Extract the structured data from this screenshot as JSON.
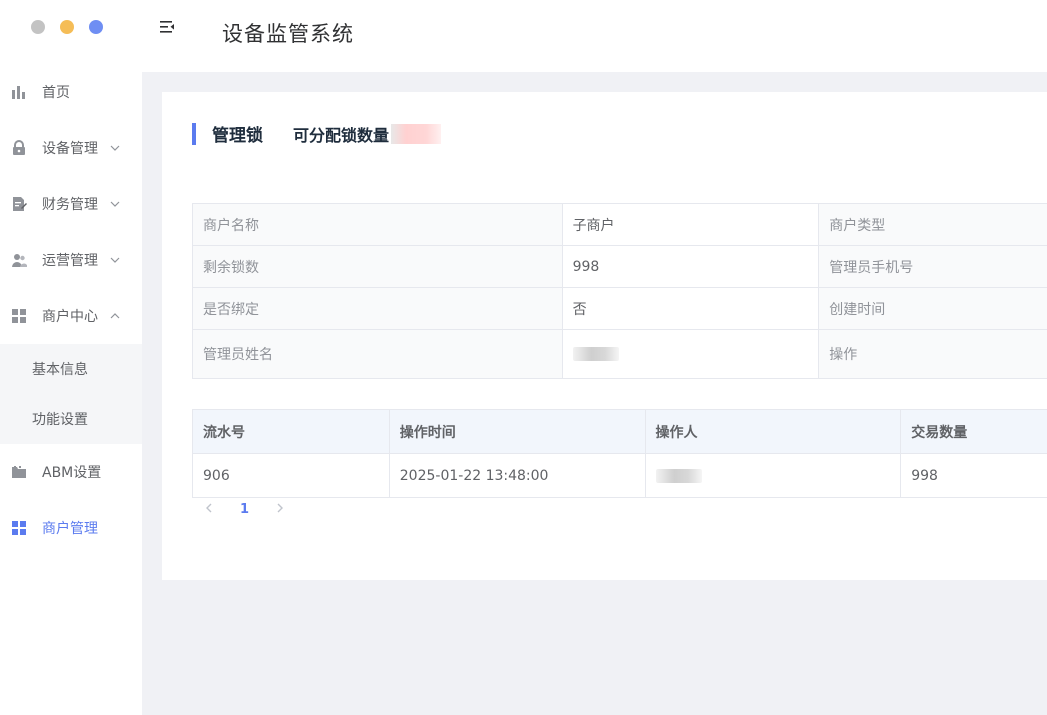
{
  "window": {
    "dots": [
      "#c3c3c3",
      "#f5bd57",
      "#6f8ef3"
    ]
  },
  "header": {
    "title": "设备监管系统",
    "menu_toggle_icon": "menu-fold-icon"
  },
  "sidebar": {
    "items": [
      {
        "label": "首页",
        "icon": "bar-chart-icon"
      },
      {
        "label": "设备管理",
        "icon": "lock-icon",
        "expanded": false
      },
      {
        "label": "财务管理",
        "icon": "document-edit-icon",
        "expanded": false
      },
      {
        "label": "运营管理",
        "icon": "users-icon",
        "expanded": false
      },
      {
        "label": "商户中心",
        "icon": "grid-icon",
        "expanded": true
      },
      {
        "label": "ABM设置",
        "icon": "folder-icon"
      },
      {
        "label": "商户管理",
        "icon": "grid-icon",
        "active": true
      }
    ],
    "submenu": [
      {
        "label": "基本信息"
      },
      {
        "label": "功能设置"
      }
    ]
  },
  "card": {
    "title": "管理锁",
    "alloc_label": "可分配锁数量"
  },
  "detail": {
    "rows": [
      {
        "label1": "商户名称",
        "value1": "子商户",
        "label2": "商户类型"
      },
      {
        "label1": "剩余锁数",
        "value1": "998",
        "label2": "管理员手机号"
      },
      {
        "label1": "是否绑定",
        "value1": "否",
        "label2": "创建时间"
      },
      {
        "label1": "管理员姓名",
        "value1": "",
        "label2": "操作"
      }
    ]
  },
  "log": {
    "headers": [
      "流水号",
      "操作时间",
      "操作人",
      "交易数量"
    ],
    "rows": [
      {
        "serial": "906",
        "time": "2025-01-22 13:48:00",
        "operator": "",
        "quantity": "998"
      }
    ]
  },
  "pagination": {
    "current": "1",
    "prev_icon": "chevron-left-icon",
    "next_icon": "chevron-right-icon"
  },
  "colors": {
    "accent": "#5b7bef",
    "main_bg": "#f0f1f5",
    "table_header_bg": "#f2f6fc"
  }
}
